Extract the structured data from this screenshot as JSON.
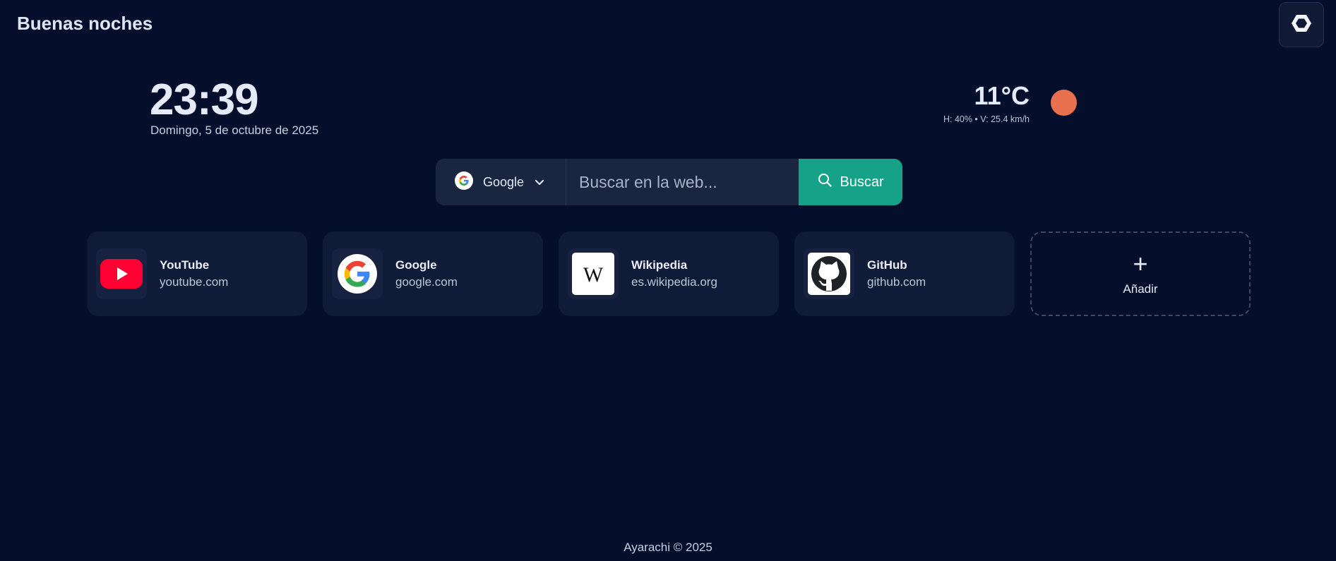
{
  "header": {
    "greeting": "Buenas noches",
    "settings_icon": "hexagon-settings-icon"
  },
  "clock": {
    "time": "23:39",
    "date": "Domingo, 5 de octubre de 2025"
  },
  "weather": {
    "temperature": "11°C",
    "details": "H: 40% • V: 25.4 km/h",
    "icon": "sun-icon",
    "icon_color": "#e9714f"
  },
  "search": {
    "engine": "Google",
    "placeholder": "Buscar en la web...",
    "button_label": "Buscar",
    "button_color": "#16a288"
  },
  "shortcuts": [
    {
      "name": "YouTube",
      "url": "youtube.com",
      "icon": "youtube-icon"
    },
    {
      "name": "Google",
      "url": "google.com",
      "icon": "google-icon"
    },
    {
      "name": "Wikipedia",
      "url": "es.wikipedia.org",
      "icon": "wikipedia-icon"
    },
    {
      "name": "GitHub",
      "url": "github.com",
      "icon": "github-icon"
    }
  ],
  "add_tile": {
    "plus": "+",
    "label": "Añadir"
  },
  "footer": {
    "text": "Ayarachi © 2025"
  },
  "colors": {
    "background": "#050f2c",
    "card": "#101b37",
    "search_bar": "#1a2540"
  }
}
